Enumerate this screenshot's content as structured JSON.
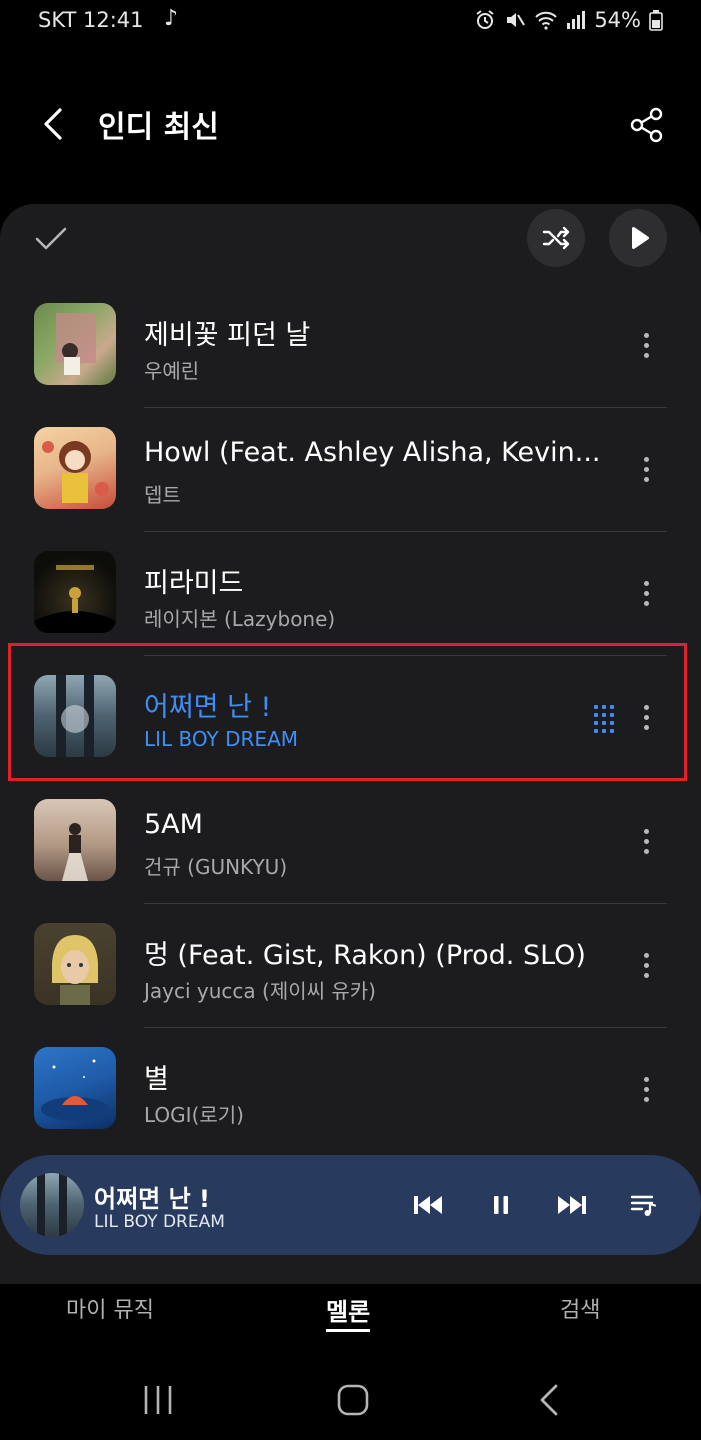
{
  "status_bar": {
    "carrier": "SKT 12:41",
    "note_glyph": "♪",
    "battery": "54%"
  },
  "header": {
    "title": "인디 최신"
  },
  "tracks": [
    {
      "title": "제비꽃 피던 날",
      "artist": "우예린",
      "art_colors": [
        "#6c8a4d",
        "#c9a98c"
      ]
    },
    {
      "title": "Howl (Feat. Ashley Alisha, Kevin...",
      "artist": "뎁트",
      "art_colors": [
        "#e8b58a",
        "#c74b3a"
      ]
    },
    {
      "title": "피라미드",
      "artist": "레이지본 (Lazybone)",
      "art_colors": [
        "#0d0d0a",
        "#c9a23a"
      ]
    },
    {
      "title": "어쩌면 난 !",
      "artist": "LIL BOY DREAM",
      "art_colors": [
        "#2c3a44",
        "#8fa7b3"
      ],
      "playing": true
    },
    {
      "title": "5AM",
      "artist": "건규 (GUNKYU)",
      "art_colors": [
        "#d9c6b6",
        "#6a5448"
      ]
    },
    {
      "title": "멍 (Feat. Gist, Rakon) (Prod. SLO)",
      "artist": "Jayci yucca (제이씨 유카)",
      "art_colors": [
        "#3a3324",
        "#e0c46a"
      ]
    },
    {
      "title": "별",
      "artist": "LOGI(로기)",
      "art_colors": [
        "#1e5ba8",
        "#0c2f66"
      ]
    }
  ],
  "mini_player": {
    "title": "어쩌면 난 !",
    "artist": "LIL BOY DREAM"
  },
  "tabs": [
    {
      "label": "마이 뮤직"
    },
    {
      "label": "멜론"
    },
    {
      "label": "검색"
    }
  ],
  "colors": {
    "accent": "#3f8ef5",
    "highlight_box": "#e0202a",
    "mini_player_bg": "#283a5e",
    "panel_bg": "#1c1c1e"
  }
}
